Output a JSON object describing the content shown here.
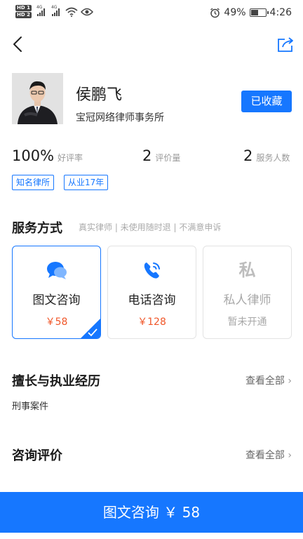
{
  "status_bar": {
    "hd1": "HD 1",
    "hd2": "HD 2",
    "signal1_label": "4G",
    "signal2_label": "4G",
    "battery": "49%",
    "time": "4:26",
    "icons": [
      "hd-icon",
      "signal-icon",
      "wifi-icon",
      "eye-icon",
      "alarm-icon",
      "battery-icon"
    ]
  },
  "nav": {
    "back_icon": "chevron-left-icon",
    "share_icon": "share-icon"
  },
  "profile": {
    "name": "侯鹏飞",
    "firm": "宝冠网络律师事务所",
    "fav_label": "已收藏"
  },
  "stats": [
    {
      "value": "100%",
      "label": "好评率"
    },
    {
      "value": "2",
      "label": "评价量"
    },
    {
      "value": "2",
      "label": "服务人数"
    }
  ],
  "tags": [
    "知名律所",
    "从业17年"
  ],
  "service": {
    "title": "服务方式",
    "subtitle": "真实律师 | 未使用随时退 | 不满意申诉",
    "cards": [
      {
        "name": "图文咨询",
        "price": "￥58",
        "icon": "chat-bubbles-icon",
        "selected": true
      },
      {
        "name": "电话咨询",
        "price": "￥128",
        "icon": "phone-icon",
        "selected": false
      },
      {
        "name": "私人律师",
        "price": "暂未开通",
        "icon": "private-icon",
        "icon_text": "私",
        "disabled": true
      }
    ]
  },
  "skills": {
    "title": "擅长与执业经历",
    "view_all": "查看全部",
    "text": "刑事案件"
  },
  "reviews": {
    "title": "咨询评价",
    "view_all": "查看全部"
  },
  "bottom_button": "图文咨询 ￥ 58",
  "colors": {
    "accent": "#1677ff",
    "price": "#f0572a",
    "muted": "#a8a8a8"
  }
}
